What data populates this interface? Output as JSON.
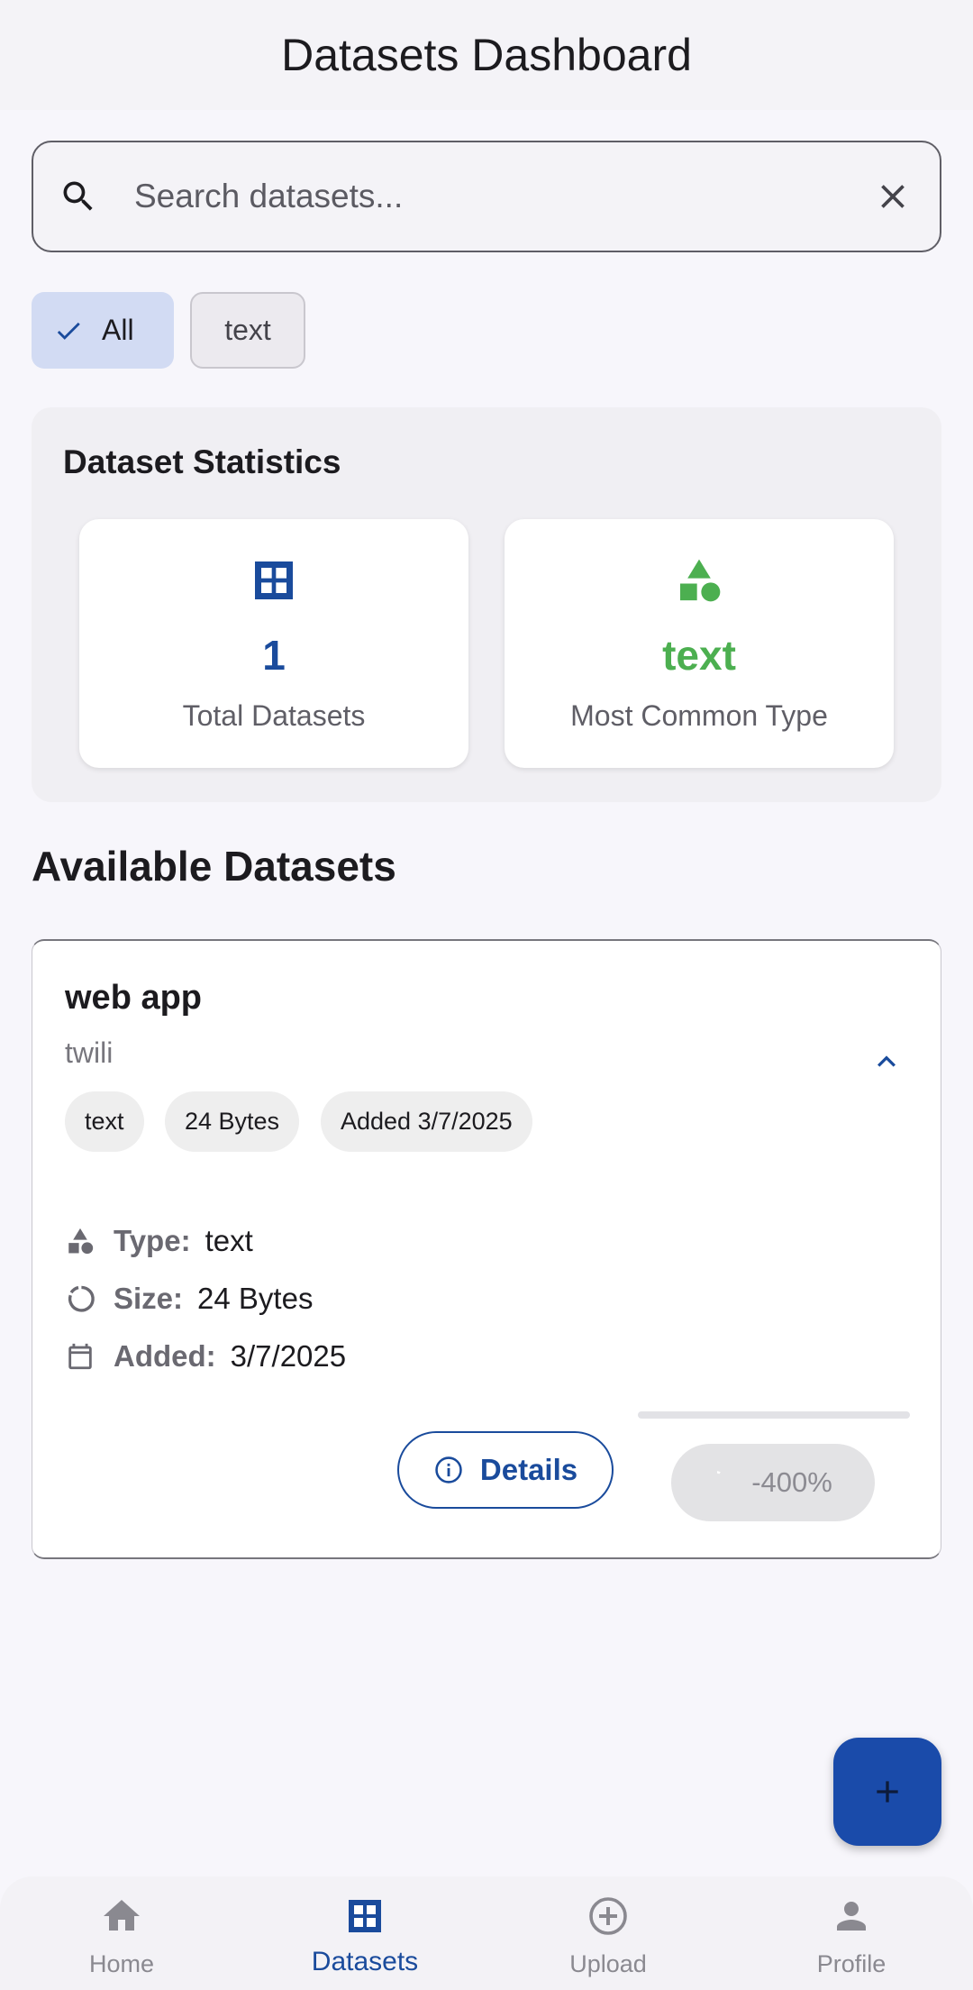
{
  "header": {
    "title": "Datasets Dashboard"
  },
  "search": {
    "placeholder": "Search datasets...",
    "search_icon": "search-icon",
    "clear_icon": "close-icon"
  },
  "filters": [
    {
      "label": "All",
      "selected": true,
      "icon": "check-icon"
    },
    {
      "label": "text",
      "selected": false
    }
  ],
  "stats": {
    "title": "Dataset Statistics",
    "total": {
      "value": "1",
      "label": "Total Datasets",
      "icon": "grid-icon",
      "color": "#1a4b9c"
    },
    "common": {
      "value": "text",
      "label": "Most Common Type",
      "icon": "shapes-icon",
      "color": "#4caf50"
    }
  },
  "section": {
    "title": "Available Datasets"
  },
  "dataset": {
    "name": "web app",
    "owner": "twili",
    "tags": [
      "text",
      "24 Bytes",
      "Added 3/7/2025"
    ],
    "type_label": "Type:",
    "type_value": "text",
    "size_label": "Size:",
    "size_value": "24 Bytes",
    "added_label": "Added:",
    "added_value": "3/7/2025",
    "details_label": "Details",
    "progress_label": "-400%"
  },
  "fab": {
    "icon": "plus-icon"
  },
  "nav": [
    {
      "label": "Home",
      "icon": "home-icon",
      "active": false
    },
    {
      "label": "Datasets",
      "icon": "grid-icon",
      "active": true
    },
    {
      "label": "Upload",
      "icon": "add-circle-icon",
      "active": false
    },
    {
      "label": "Profile",
      "icon": "person-icon",
      "active": false
    }
  ],
  "colors": {
    "primary": "#1a4b9c",
    "accent_green": "#4caf50",
    "chip_selected": "#d2dbf3"
  }
}
